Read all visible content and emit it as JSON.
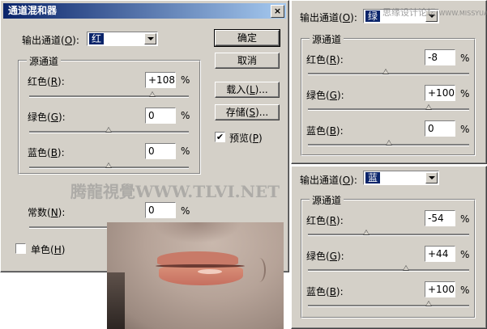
{
  "main_dialog": {
    "title": "通道混和器",
    "close_glyph": "×",
    "output_label": "输出通道(",
    "output_key": "O",
    "output_label_end": "):",
    "output_value": "红",
    "source_group": "源通道",
    "sliders": [
      {
        "label": "红色(",
        "key": "R",
        "end": "):",
        "value": "+108",
        "pct": "%",
        "level": 108
      },
      {
        "label": "绿色(",
        "key": "G",
        "end": "):",
        "value": "0",
        "pct": "%",
        "level": 0
      },
      {
        "label": "蓝色(",
        "key": "B",
        "end": "):",
        "value": "0",
        "pct": "%",
        "level": 0
      }
    ],
    "constant": {
      "label": "常数(",
      "key": "N",
      "end": "):",
      "value": "0",
      "pct": "%",
      "level": 0
    },
    "mono": {
      "label": "单色(",
      "key": "H",
      "end": ")",
      "checked": false
    },
    "buttons": {
      "ok": "确定",
      "cancel": "取消",
      "load_pre": "载入(",
      "load_key": "L",
      "load_post": ")...",
      "save_pre": "存储(",
      "save_key": "S",
      "save_post": ")..."
    },
    "preview": {
      "label": "预览(",
      "key": "P",
      "end": ")",
      "checked": true,
      "check_glyph": "✔"
    }
  },
  "green_panel": {
    "output_label": "输出通道(",
    "output_key": "O",
    "output_label_end": "):",
    "output_value": "绿",
    "source_group": "源通道",
    "sliders": [
      {
        "label": "红色(",
        "key": "R",
        "end": "):",
        "value": "-8",
        "pct": "%",
        "level": -8
      },
      {
        "label": "绿色(",
        "key": "G",
        "end": "):",
        "value": "+100",
        "pct": "%",
        "level": 100
      },
      {
        "label": "蓝色(",
        "key": "B",
        "end": "):",
        "value": "0",
        "pct": "%",
        "level": 0
      }
    ]
  },
  "blue_panel": {
    "output_label": "输出通道(",
    "output_key": "O",
    "output_label_end": "):",
    "output_value": "蓝",
    "source_group": "源通道",
    "sliders": [
      {
        "label": "红色(",
        "key": "R",
        "end": "):",
        "value": "-54",
        "pct": "%",
        "level": -54
      },
      {
        "label": "绿色(",
        "key": "G",
        "end": "):",
        "value": "+44",
        "pct": "%",
        "level": 44
      },
      {
        "label": "蓝色(",
        "key": "B",
        "end": "):",
        "value": "+100",
        "pct": "%",
        "level": 100
      }
    ]
  },
  "watermarks": {
    "main": "腾龍視覺WWW.TLVI.NET",
    "top_right": "思缘设计论坛",
    "top_right_url": "WWW.MISSYUAN.COM"
  },
  "colors": {
    "dialog_bg": "#d4d0c8",
    "title_start": "#0a246a",
    "title_end": "#a6caf0",
    "selection": "#0a246a"
  }
}
